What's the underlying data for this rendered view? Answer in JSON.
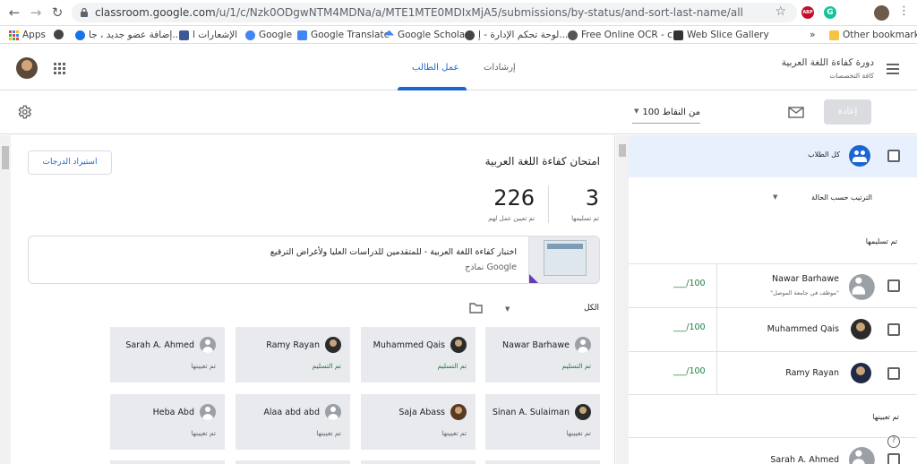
{
  "browser": {
    "url_host": "classroom.google.com",
    "url_path": "/u/1/c/Nzk0ODgwNTM4MDNa/a/MTE1MTE0MDIxMjA5/submissions/by-status/and-sort-last-name/all",
    "bookmarks": [
      {
        "label": "Apps",
        "color": "#4285f4"
      },
      {
        "label": "إضافة عضو جديد ، جا...",
        "color": "#444444"
      },
      {
        "label": "الإشعارات ا",
        "color": "#3b5998"
      },
      {
        "label": "Google",
        "color": "#4285f4"
      },
      {
        "label": "Google Translate",
        "color": "#4285f4"
      },
      {
        "label": "Google Scholar",
        "color": "#4285f4"
      },
      {
        "label": "لوحة تحكم الإدارة - إ...",
        "color": "#444444"
      },
      {
        "label": "Free Online OCR - c...",
        "color": "#555555"
      },
      {
        "label": "Web Slice Gallery",
        "color": "#333333"
      },
      {
        "label": "Other bookmarks",
        "color": "#f4c542"
      }
    ],
    "ext_badge": "ABP"
  },
  "header": {
    "course_title": "دورة كفاءة اللغة العربية",
    "course_subtitle": "كافة التخصصات",
    "tabs": [
      {
        "label": "إرشادات",
        "active": false
      },
      {
        "label": "عمل الطالب",
        "active": true
      }
    ]
  },
  "toolbar": {
    "return_label": "إعادة",
    "points_value": "100 من النقاط"
  },
  "assignment": {
    "title": "امتحان كفاءة اللغة العربية",
    "turned_in_count": "3",
    "turned_in_label": "تم تسليمها",
    "assigned_count": "226",
    "assigned_label": "تم تعيين عمل لهم",
    "import_grades_label": "استيراد الدرجات",
    "form_title": "اختبار كفاءة اللغة العربية - للمتقدمين للدراسات العليا ولأغراض الترقيع",
    "form_source": "نماذج Google",
    "filter_label": "الكل"
  },
  "cards": [
    {
      "name": "Nawar Barhawe",
      "status": "تم التسليم",
      "status_color": "green",
      "avatar": "generic"
    },
    {
      "name": "Muhammed Qais",
      "status": "تم التسليم",
      "status_color": "green",
      "avatar": "photo"
    },
    {
      "name": "Ramy Rayan",
      "status": "تم التسليم",
      "status_color": "green",
      "avatar": "photo"
    },
    {
      "name": "Sarah A. Ahmed",
      "status": "تم تعيينها",
      "status_color": "grey",
      "avatar": "generic"
    },
    {
      "name": "Sinan A. Sulaiman",
      "status": "تم تعيينها",
      "status_color": "grey",
      "avatar": "photo"
    },
    {
      "name": "Saja Abass",
      "status": "تم تعيينها",
      "status_color": "grey",
      "avatar": "photo"
    },
    {
      "name": "Alaa abd abd",
      "status": "تم تعيينها",
      "status_color": "grey",
      "avatar": "generic"
    },
    {
      "name": "Heba Abd",
      "status": "تم تعيينها",
      "status_color": "grey",
      "avatar": "generic"
    }
  ],
  "roster": {
    "all_students_label": "كل الطلاب",
    "sort_label": "الترتيب حسب الحالة",
    "section_turned_in": "تم تسليمها",
    "section_assigned": "تم تعيينها",
    "students": [
      {
        "name": "Nawar Barhawe",
        "note": "\"موظف في جامعة الموصل\"",
        "grade": "___/100",
        "avatar": "generic"
      },
      {
        "name": "Muhammed Qais",
        "note": "",
        "grade": "___/100",
        "avatar": "photo"
      },
      {
        "name": "Ramy Rayan",
        "note": "",
        "grade": "___/100",
        "avatar": "photo"
      }
    ],
    "assigned_students": [
      {
        "name": "Sarah A. Ahmed",
        "avatar": "generic"
      }
    ]
  }
}
